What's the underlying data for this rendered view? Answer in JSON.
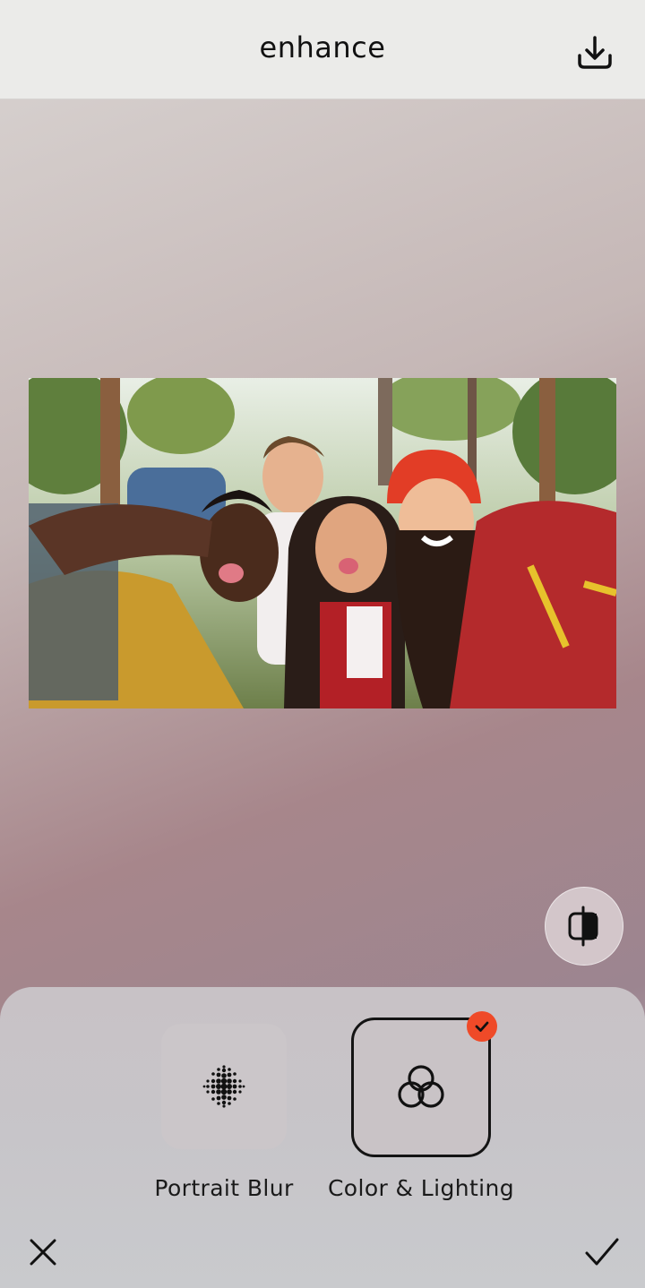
{
  "header": {
    "title": "enhance",
    "download_icon": "download-icon"
  },
  "canvas": {
    "image_alt": "Group selfie of four friends in a forest",
    "compare_icon": "compare-split-icon"
  },
  "tools": [
    {
      "label": "Portrait Blur",
      "icon": "dot-grid-icon",
      "selected": false
    },
    {
      "label": "Color & Lighting",
      "icon": "interlocking-circles-icon",
      "selected": true
    }
  ],
  "footer": {
    "cancel_icon": "close-icon",
    "confirm_icon": "checkmark-icon"
  },
  "colors": {
    "accent": "#ef4a28",
    "header_bg": "#ebebe9",
    "selected_border": "#141414"
  }
}
